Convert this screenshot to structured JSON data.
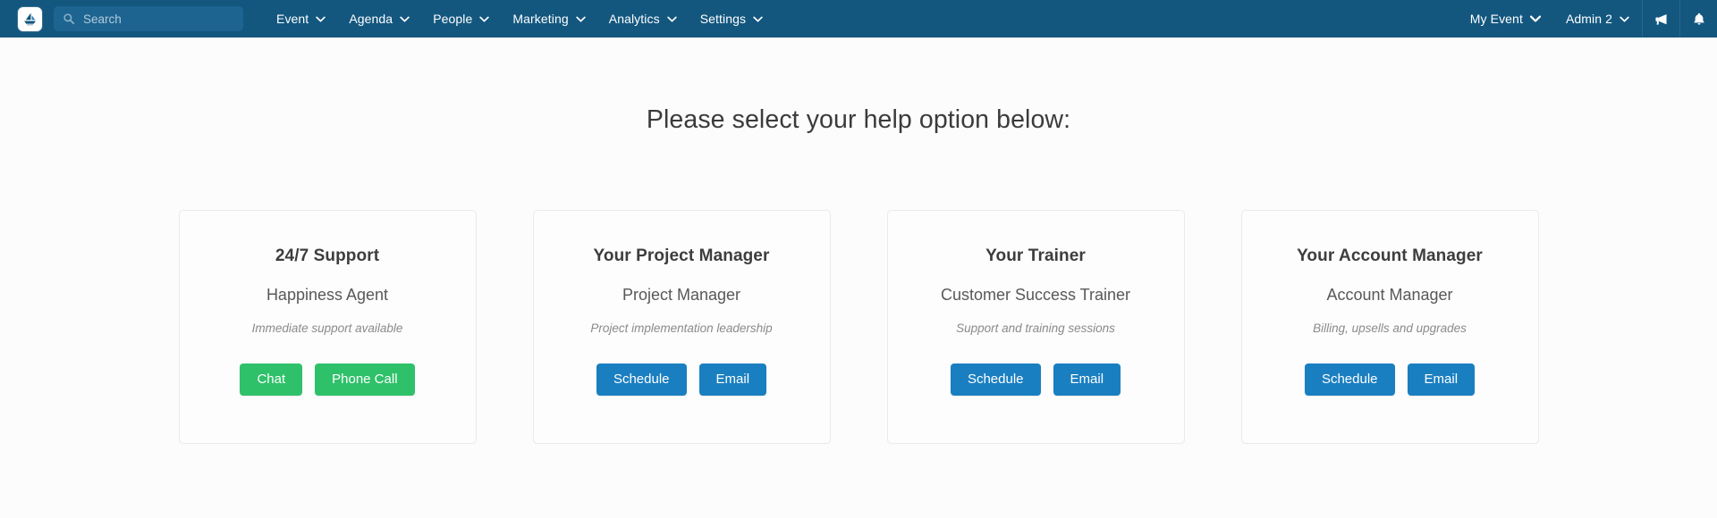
{
  "navbar": {
    "brand_icon": "sailboat-logo-icon",
    "background_color": "#13577f",
    "search": {
      "icon": "search-icon",
      "placeholder": "Search",
      "value": ""
    },
    "menu_items": [
      {
        "label": "Event",
        "caret": "chevron-down-icon"
      },
      {
        "label": "Agenda",
        "caret": "chevron-down-icon"
      },
      {
        "label": "People",
        "caret": "chevron-down-icon"
      },
      {
        "label": "Marketing",
        "caret": "chevron-down-icon"
      },
      {
        "label": "Analytics",
        "caret": "chevron-down-icon"
      },
      {
        "label": "Settings",
        "caret": "chevron-down-icon"
      }
    ],
    "right_items": [
      {
        "label": "My Event",
        "caret": "chevron-down-icon"
      },
      {
        "label": "Admin 2",
        "caret": "chevron-down-icon"
      }
    ],
    "right_icons": [
      {
        "name": "megaphone-icon"
      },
      {
        "name": "bell-icon"
      }
    ]
  },
  "main": {
    "title": "Please select your help option below:",
    "cards": [
      {
        "title": "24/7 Support",
        "role": "Happiness Agent",
        "description": "Immediate support available",
        "buttons": [
          {
            "label": "Chat",
            "style": "green",
            "color": "#2fc16a"
          },
          {
            "label": "Phone Call",
            "style": "green",
            "color": "#2fc16a"
          }
        ]
      },
      {
        "title": "Your Project Manager",
        "role": "Project Manager",
        "description": "Project implementation leadership",
        "buttons": [
          {
            "label": "Schedule",
            "style": "blue",
            "color": "#1a7fc1"
          },
          {
            "label": "Email",
            "style": "blue",
            "color": "#1a7fc1"
          }
        ]
      },
      {
        "title": "Your Trainer",
        "role": "Customer Success Trainer",
        "description": "Support and training sessions",
        "buttons": [
          {
            "label": "Schedule",
            "style": "blue",
            "color": "#1a7fc1"
          },
          {
            "label": "Email",
            "style": "blue",
            "color": "#1a7fc1"
          }
        ]
      },
      {
        "title": "Your Account Manager",
        "role": "Account Manager",
        "description": "Billing, upsells and upgrades",
        "buttons": [
          {
            "label": "Schedule",
            "style": "blue",
            "color": "#1a7fc1"
          },
          {
            "label": "Email",
            "style": "blue",
            "color": "#1a7fc1"
          }
        ]
      }
    ]
  }
}
